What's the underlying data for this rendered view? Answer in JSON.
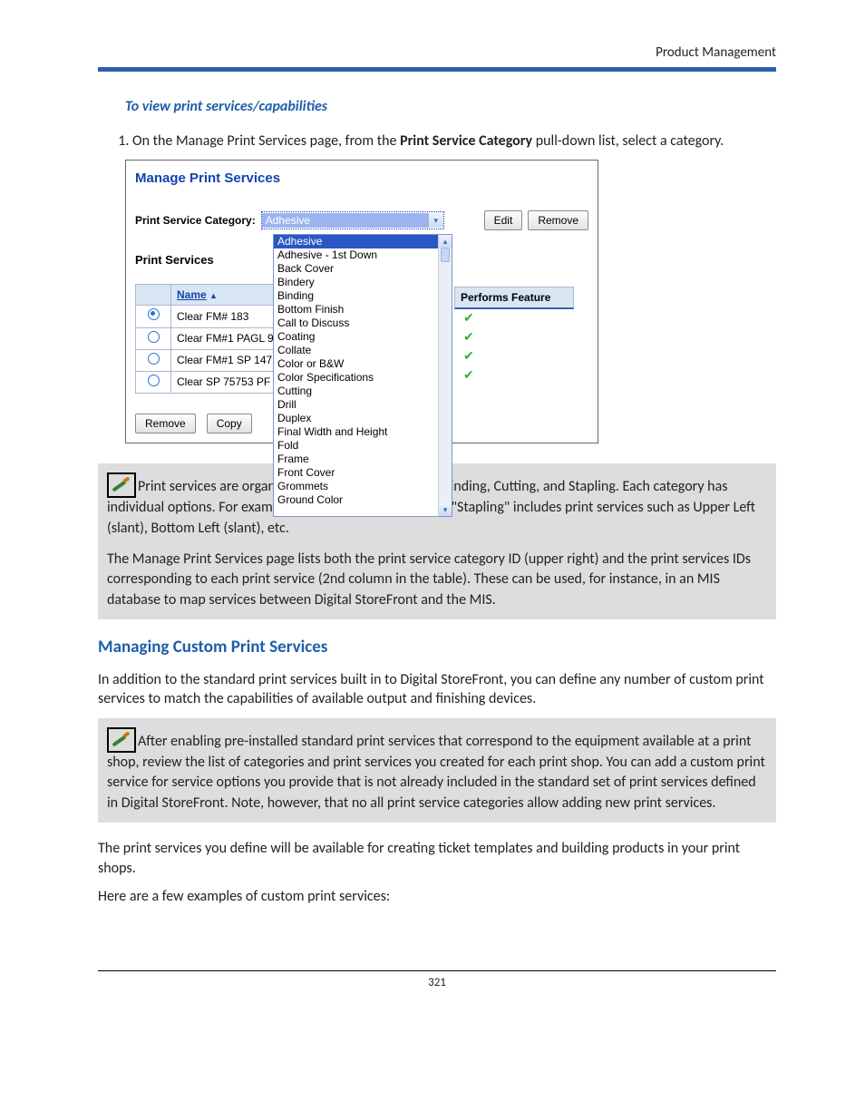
{
  "header": {
    "running": "Product Management"
  },
  "stepHeading": "To view print services/capabilities",
  "step1": {
    "prefix": "On the Manage Print Services page, from the ",
    "bold": "Print Service Category",
    "suffix": " pull-down list, select a category."
  },
  "screenshot": {
    "title": "Manage Print Services",
    "catLabel": "Print Service Category:",
    "catSelected": "Adhesive",
    "editBtn": "Edit",
    "removeBtn": "Remove",
    "psHeading": "Print Services",
    "nameHeader": "Name",
    "perfHeader": "Performs Feature",
    "rows": [
      {
        "selected": true,
        "name": "Clear FM# 183"
      },
      {
        "selected": false,
        "name": "Clear FM#1 PAGL 9"
      },
      {
        "selected": false,
        "name": "Clear FM#1 SP 147"
      },
      {
        "selected": false,
        "name": "Clear SP 75753 PF"
      }
    ],
    "removeBtn2": "Remove",
    "copyBtn": "Copy",
    "options": [
      "Adhesive",
      "Adhesive - 1st Down",
      "Back Cover",
      "Bindery",
      "Binding",
      "Bottom Finish",
      "Call to Discuss",
      "Coating",
      "Collate",
      "Color or B&W",
      "Color Specifications",
      "Cutting",
      "Drill",
      "Duplex",
      "Final Width and Height",
      "Fold",
      "Frame",
      "Front Cover",
      "Grommets",
      "Ground Color"
    ]
  },
  "note1a": "Print services are organized into categories, such as Binding, Cutting, and Stapling. Each category has individual options. For example, the print service category \"Stapling\" includes print services such as Upper Left (slant), Bottom Left (slant), etc.",
  "note1b": "The Manage Print Services page lists both the print service category ID (upper right) and the print services IDs corresponding to each print service (2nd column in the table). These can be used, for instance, in an MIS database to map services between Digital StoreFront and the MIS.",
  "section2": "Managing Custom Print Services",
  "para2": "In addition to the standard print services built in to Digital StoreFront, you can define any number of custom print services to match the capabilities of available output and finishing devices.",
  "note2": "After enabling pre-installed standard print services that correspond to the equipment available at a print shop, review the list of categories and print services you created for each print shop. You can add a custom print service for service options you provide that is not already included in the standard set of print services defined in Digital StoreFront. Note, however, that no all print service categories allow adding new print services.",
  "para3": "The print services you define will be available for creating ticket templates and building products in your print shops.",
  "para4": "Here are a few examples of custom print services:",
  "pageNumber": "321"
}
